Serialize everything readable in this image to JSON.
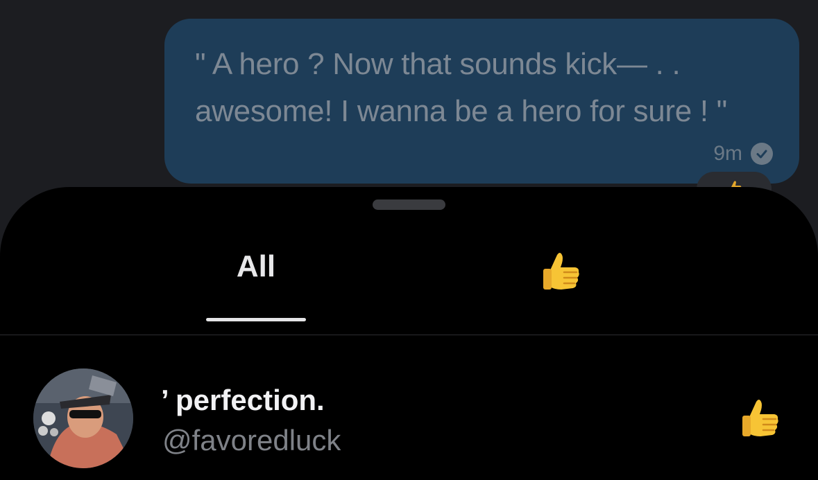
{
  "message": {
    "text": "\" A hero ? Now that sounds kick— . .\nawesome! I wanna be a hero for sure ! \"",
    "time": "9m",
    "status_icon": "checkmark-circle-icon"
  },
  "reactions_sheet": {
    "tabs": [
      {
        "label": "All",
        "selected": true
      },
      {
        "label": "👍",
        "selected": false
      }
    ],
    "users": [
      {
        "name": "’ perfection.",
        "handle": "@favoredluck",
        "reaction": "👍"
      }
    ]
  },
  "colors": {
    "bubble": "#1e3d58",
    "sheet": "#000000",
    "background": "#1c1d21",
    "thumb": "#f7c435"
  }
}
